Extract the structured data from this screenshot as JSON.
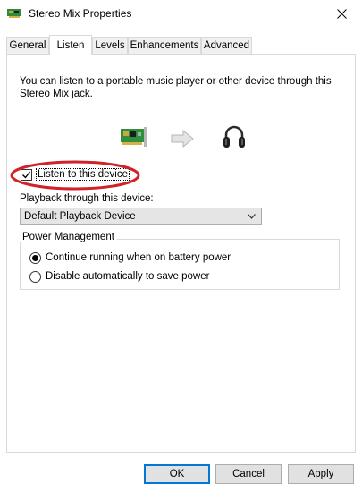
{
  "window": {
    "title": "Stereo Mix Properties",
    "close_symbol": "✕"
  },
  "tabs": [
    {
      "label": "General",
      "active": false
    },
    {
      "label": "Listen",
      "active": true
    },
    {
      "label": "Levels",
      "active": false
    },
    {
      "label": "Enhancements",
      "active": false
    },
    {
      "label": "Advanced",
      "active": false
    }
  ],
  "listen": {
    "description": "You can listen to a portable music player or other device through this Stereo Mix jack.",
    "listen_checkbox_label": "Listen to this device",
    "listen_checked": true,
    "playback_label": "Playback through this device:",
    "playback_selected": "Default Playback Device"
  },
  "power": {
    "legend": "Power Management",
    "option_continue": "Continue running when on battery power",
    "option_disable": "Disable automatically to save power",
    "selected": "continue"
  },
  "buttons": {
    "ok": "OK",
    "cancel": "Cancel",
    "apply": "Apply"
  },
  "colors": {
    "annotation_red": "#d0232a",
    "focus_blue": "#0078d7"
  },
  "icons": {
    "title": "sound-card-icon",
    "source": "sound-card-icon",
    "flow": "arrow-right-icon",
    "output": "headphones-icon"
  }
}
